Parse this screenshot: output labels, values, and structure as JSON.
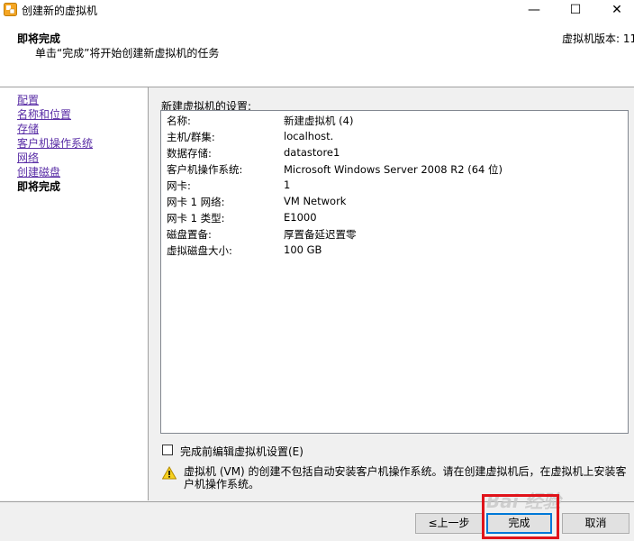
{
  "window": {
    "title": "创建新的虚拟机",
    "minimize_icon": "minimize-icon",
    "maximize_icon": "maximize-icon",
    "close_icon": "close-icon",
    "minimize_glyph": "—",
    "maximize_glyph": "☐",
    "close_glyph": "✕"
  },
  "header": {
    "title": "即将完成",
    "subtitle": "单击“完成”将开始创建新虚拟机的任务",
    "version": "虚拟机版本: 11"
  },
  "nav": {
    "items": [
      {
        "label": "配置",
        "active": false
      },
      {
        "label": "名称和位置",
        "active": false
      },
      {
        "label": "存储",
        "active": false
      },
      {
        "label": "客户机操作系统",
        "active": false
      },
      {
        "label": "网络",
        "active": false
      },
      {
        "label": "创建磁盘",
        "active": false
      },
      {
        "label": "即将完成",
        "active": true
      }
    ]
  },
  "settings": {
    "group_label": "新建虚拟机的设置:",
    "rows": [
      {
        "key": "名称:",
        "value": "新建虚拟机 (4)"
      },
      {
        "key": "主机/群集:",
        "value": "localhost."
      },
      {
        "key": "数据存储:",
        "value": "datastore1"
      },
      {
        "key": "客户机操作系统:",
        "value": "Microsoft Windows Server 2008 R2 (64 位)"
      },
      {
        "key": "网卡:",
        "value": "1"
      },
      {
        "key": "网卡 1 网络:",
        "value": "VM Network"
      },
      {
        "key": "网卡 1 类型:",
        "value": "E1000"
      },
      {
        "key": "磁盘置备:",
        "value": "厚置备延迟置零"
      },
      {
        "key": "虚拟磁盘大小:",
        "value": "100 GB"
      }
    ]
  },
  "checkbox": {
    "label": "完成前编辑虚拟机设置(E)",
    "checked": false
  },
  "warning": {
    "icon": "warning-icon",
    "text": "虚拟机 (VM) 的创建不包括自动安装客户机操作系统。请在创建虚拟机后，在虚拟机上安装客户机操作系统。"
  },
  "buttons": {
    "back": "≤上一步",
    "finish": "完成",
    "cancel": "取消"
  },
  "watermark": "Bai 经验",
  "colors": {
    "link": "#5a2ea6",
    "highlight": "#e0131a",
    "focus": "#0078d7"
  }
}
